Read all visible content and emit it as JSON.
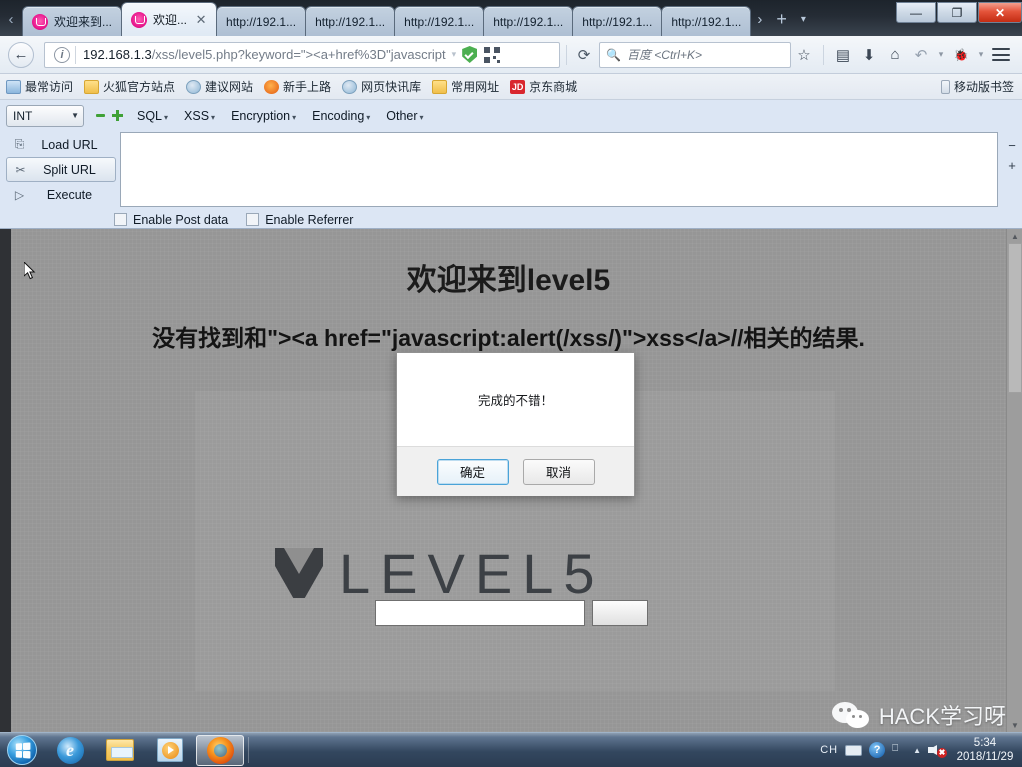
{
  "browser": {
    "tabs": [
      {
        "title": "欢迎来到...",
        "icon": "level-favicon",
        "active": false,
        "closable": false
      },
      {
        "title": "欢迎...",
        "icon": "level-favicon",
        "active": true,
        "closable": true
      },
      {
        "title": "http://192.1...",
        "icon": "",
        "active": false,
        "closable": false
      },
      {
        "title": "http://192.1...",
        "icon": "",
        "active": false,
        "closable": false
      },
      {
        "title": "http://192.1...",
        "icon": "",
        "active": false,
        "closable": false
      },
      {
        "title": "http://192.1...",
        "icon": "",
        "active": false,
        "closable": false
      },
      {
        "title": "http://192.1...",
        "icon": "",
        "active": false,
        "closable": false
      },
      {
        "title": "http://192.1...",
        "icon": "",
        "active": false,
        "closable": false
      }
    ],
    "tab_scroll_left": "‹",
    "tab_scroll_right": "›",
    "new_tab_label": "+",
    "tab_list_label": "▾",
    "window_controls": {
      "minimize": "—",
      "restore": "❐",
      "close": "✕"
    },
    "nav": {
      "back_icon": "←",
      "url_host": "192.168.1.3",
      "url_path": "/xss/level5.php?keyword=\"><a+href%3D\"javascript",
      "url_full": "192.168.1.3/xss/level5.php?keyword=\"><a+href%3D\"javascript",
      "identity_icon": "i",
      "dropdown_caret": "▾",
      "shield_icon": "shield-icon",
      "qr_icon": "qr-icon",
      "reload_icon": "⟳",
      "bookmark_star_icon": "☆",
      "reader_icon": "▤",
      "download_icon": "⬇",
      "home_icon": "⌂",
      "history_icon": "↶",
      "history_caret": "▾",
      "addon_icon": "🐞",
      "addon_caret": "▾",
      "menu_icon": "hamburger-icon"
    },
    "search": {
      "icon": "search-icon",
      "placeholder": "百度 <Ctrl+K>",
      "value": ""
    },
    "bookmarks": [
      {
        "label": "最常访问",
        "icon": "most-visited-icon"
      },
      {
        "label": "火狐官方站点",
        "icon": "folder-icon"
      },
      {
        "label": "建议网站",
        "icon": "globe-icon"
      },
      {
        "label": "新手上路",
        "icon": "firefox-icon"
      },
      {
        "label": "网页快讯库",
        "icon": "globe-icon"
      },
      {
        "label": "常用网址",
        "icon": "folder-icon"
      },
      {
        "label": "京东商城",
        "icon": "jd-icon",
        "badge": "JD"
      }
    ],
    "bookmarks_right": {
      "label": "移动版书签",
      "icon": "phone-icon"
    }
  },
  "hackbar": {
    "mode_select": {
      "value": "INT",
      "caret": "▼"
    },
    "minus_label": "−",
    "plus_label": "+",
    "menus": [
      {
        "label": "SQL",
        "caret": "▾"
      },
      {
        "label": "XSS",
        "caret": "▾"
      },
      {
        "label": "Encryption",
        "caret": "▾"
      },
      {
        "label": "Encoding",
        "caret": "▾"
      },
      {
        "label": "Other",
        "caret": "▾"
      }
    ],
    "buttons": [
      {
        "label": "Load URL",
        "icon": "load-url-icon",
        "pressed": false
      },
      {
        "label": "Split URL",
        "icon": "split-url-icon",
        "pressed": true
      },
      {
        "label": "Execute",
        "icon": "execute-icon",
        "pressed": false
      }
    ],
    "textarea_value": "",
    "side_minus": "−",
    "side_plus": "+",
    "checkboxes": [
      {
        "label": "Enable Post data",
        "checked": false
      },
      {
        "label": "Enable Referrer",
        "checked": false
      }
    ]
  },
  "page": {
    "heading": "欢迎来到level5",
    "result_text": "没有找到和\"><a href=\"javascript:alert(/xss/)\">xss</a>//相关的结果.",
    "search_input_value": "",
    "search_button_label": "",
    "logo_text": "LEVEL5",
    "logo_mark": "level-logo-icon"
  },
  "dialog": {
    "message": "完成的不错！",
    "ok_label": "确定",
    "cancel_label": "取消"
  },
  "watermark": {
    "text": "HACK学习呀",
    "icon": "wechat-icon"
  },
  "taskbar": {
    "start_label": "start-orb",
    "items": [
      {
        "name": "internet-explorer",
        "glyph": "e"
      },
      {
        "name": "windows-explorer",
        "glyph": ""
      },
      {
        "name": "windows-media-player",
        "glyph": ""
      },
      {
        "name": "firefox",
        "glyph": "",
        "active": true
      }
    ],
    "tray": {
      "ime": "CH",
      "keyboard_icon": "keyboard-icon",
      "help_icon": "?",
      "network_icon": "network-icon",
      "show_hidden_icon": "▲",
      "volume_icon": "volume-muted-icon",
      "time": "5:34",
      "date": "2018/11/29"
    }
  },
  "colors": {
    "tab_active": "#eef4fa",
    "chrome_dark": "#242b34",
    "hackbar_bg": "#dce6f4",
    "page_bg": "#969696",
    "accent_green": "#3fa136",
    "close_red": "#c32c13"
  }
}
